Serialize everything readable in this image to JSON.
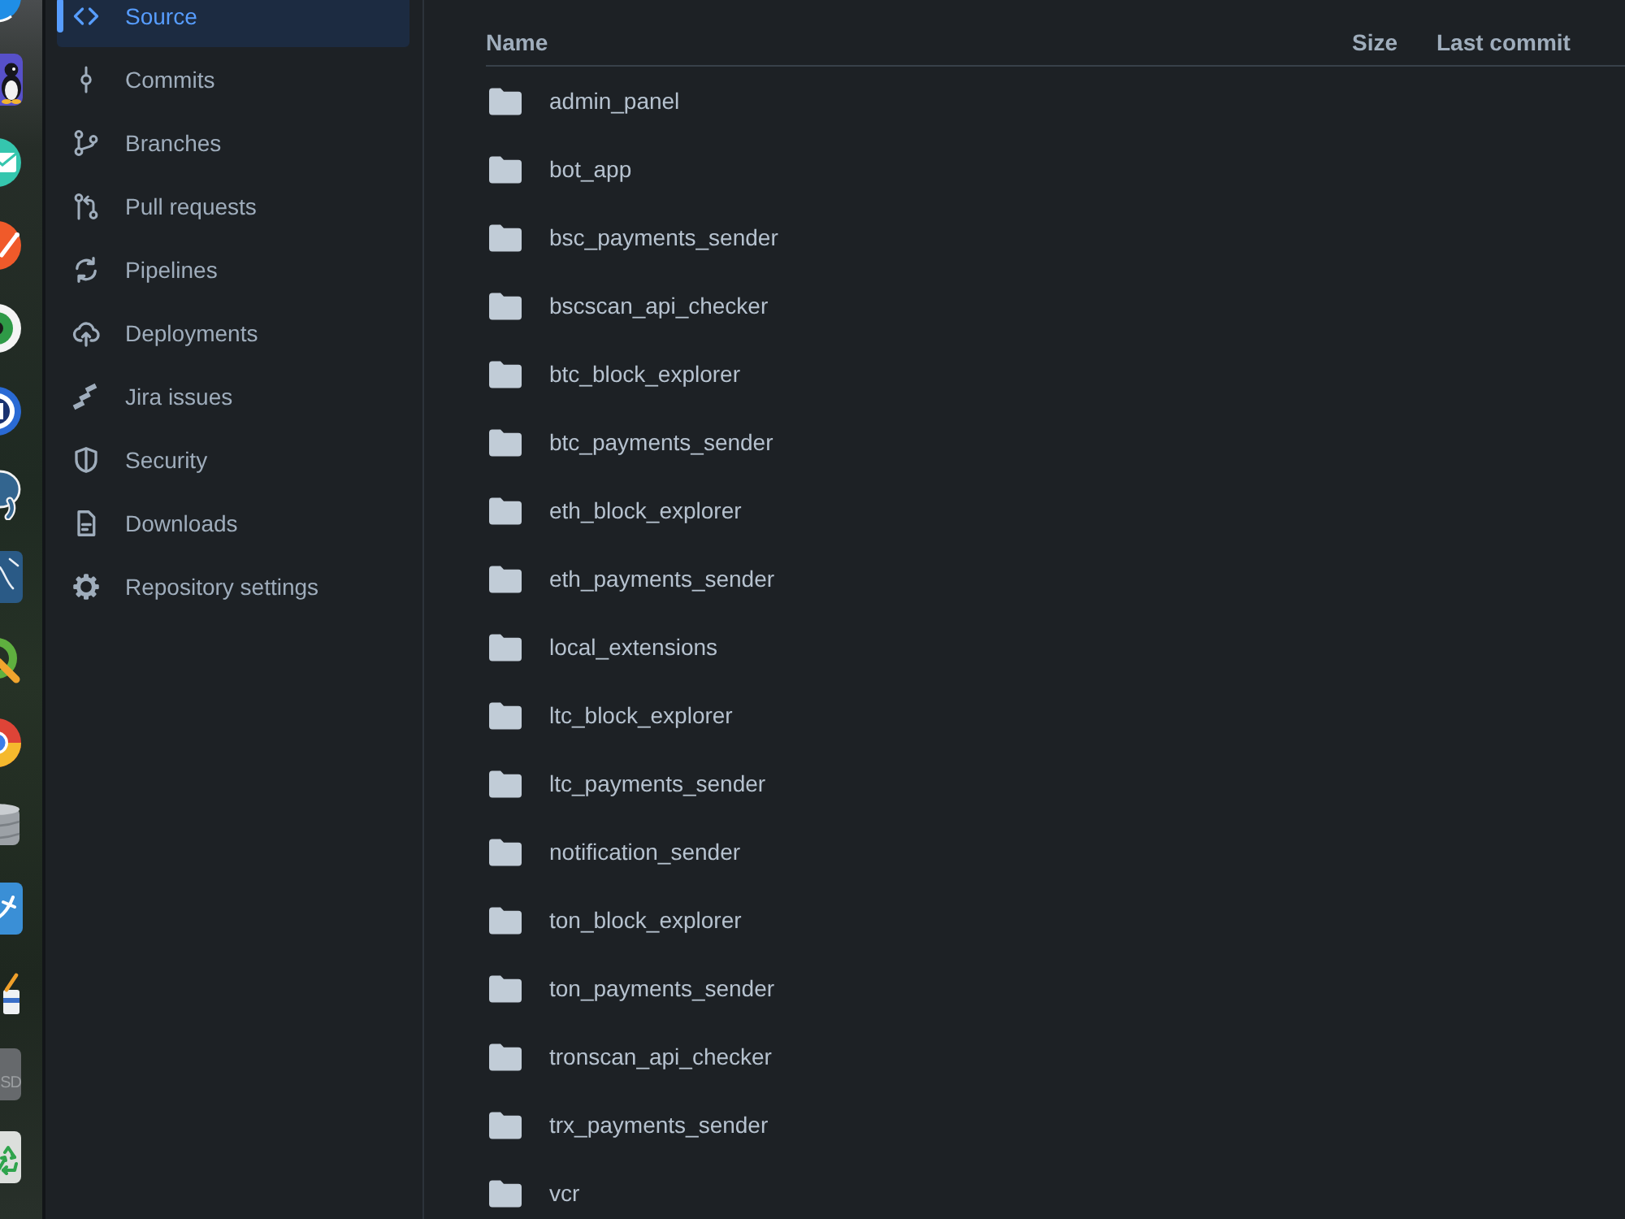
{
  "dock": {
    "drive_label": "SD"
  },
  "sidebar": {
    "items": [
      {
        "label": "Source",
        "selected": true
      },
      {
        "label": "Commits",
        "selected": false
      },
      {
        "label": "Branches",
        "selected": false
      },
      {
        "label": "Pull requests",
        "selected": false
      },
      {
        "label": "Pipelines",
        "selected": false
      },
      {
        "label": "Deployments",
        "selected": false
      },
      {
        "label": "Jira issues",
        "selected": false
      },
      {
        "label": "Security",
        "selected": false
      },
      {
        "label": "Downloads",
        "selected": false
      },
      {
        "label": "Repository settings",
        "selected": false
      }
    ]
  },
  "table": {
    "columns": [
      "Name",
      "Size",
      "Last commit"
    ],
    "rows": [
      {
        "name": "admin_panel"
      },
      {
        "name": "bot_app"
      },
      {
        "name": "bsc_payments_sender"
      },
      {
        "name": "bscscan_api_checker"
      },
      {
        "name": "btc_block_explorer"
      },
      {
        "name": "btc_payments_sender"
      },
      {
        "name": "eth_block_explorer"
      },
      {
        "name": "eth_payments_sender"
      },
      {
        "name": "local_extensions"
      },
      {
        "name": "ltc_block_explorer"
      },
      {
        "name": "ltc_payments_sender"
      },
      {
        "name": "notification_sender"
      },
      {
        "name": "ton_block_explorer"
      },
      {
        "name": "ton_payments_sender"
      },
      {
        "name": "tronscan_api_checker"
      },
      {
        "name": "trx_payments_sender"
      },
      {
        "name": "vcr"
      }
    ]
  }
}
